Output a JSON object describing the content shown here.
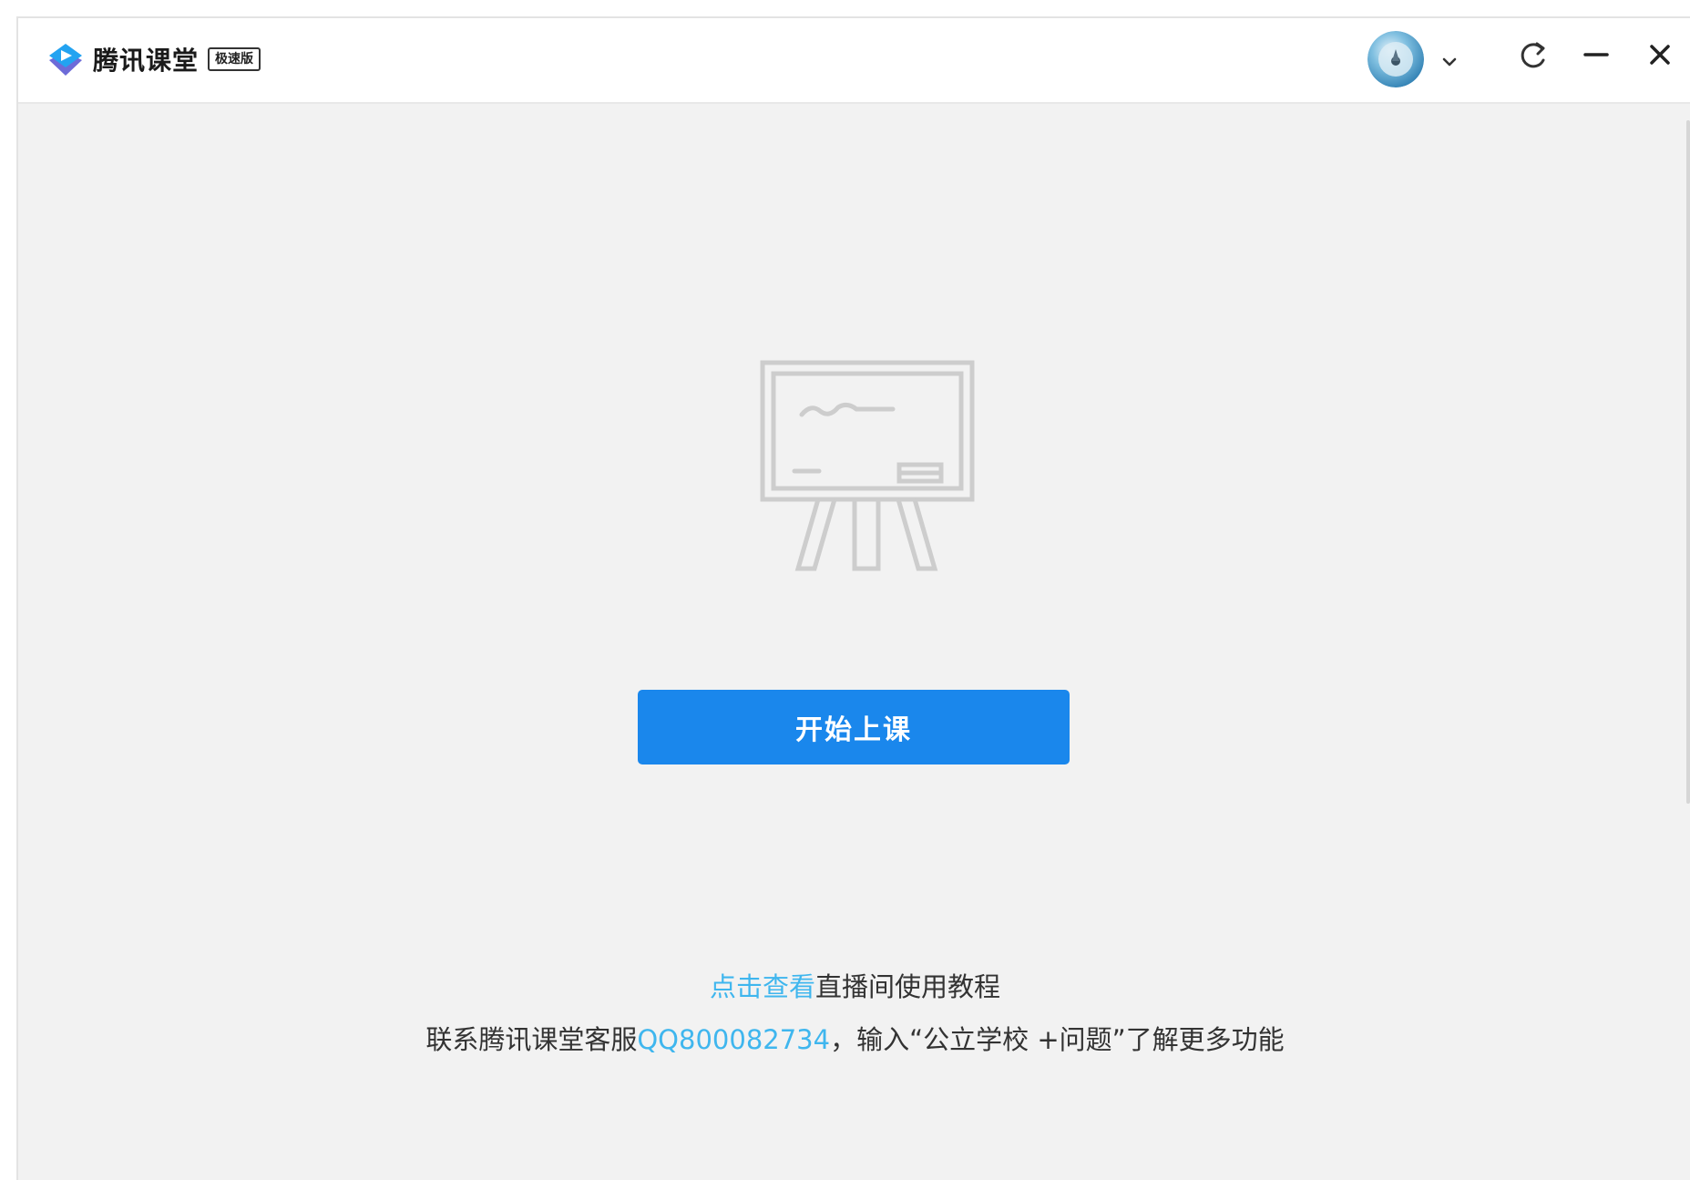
{
  "titlebar": {
    "app_name": "腾讯课堂",
    "edition_badge": "极速版",
    "icons": {
      "logo": "tencent-classroom-logo",
      "account_menu": "chevron-down-icon",
      "refresh": "refresh-icon",
      "minimize": "minimize-icon",
      "close": "close-icon"
    }
  },
  "main": {
    "illustration": "blackboard-easel-icon",
    "start_button_label": "开始上课",
    "tutorial": {
      "link_text": "点击查看",
      "text": "直播间使用教程"
    },
    "contact": {
      "prefix": "联系腾讯课堂客服",
      "qq_link": "QQ800082734",
      "suffix": "，输入“公立学校 +问题”了解更多功能"
    }
  },
  "colors": {
    "primary_button": "#1a87ec",
    "link": "#3fb6ee",
    "background": "#f2f2f2",
    "titlebar": "#ffffff"
  }
}
